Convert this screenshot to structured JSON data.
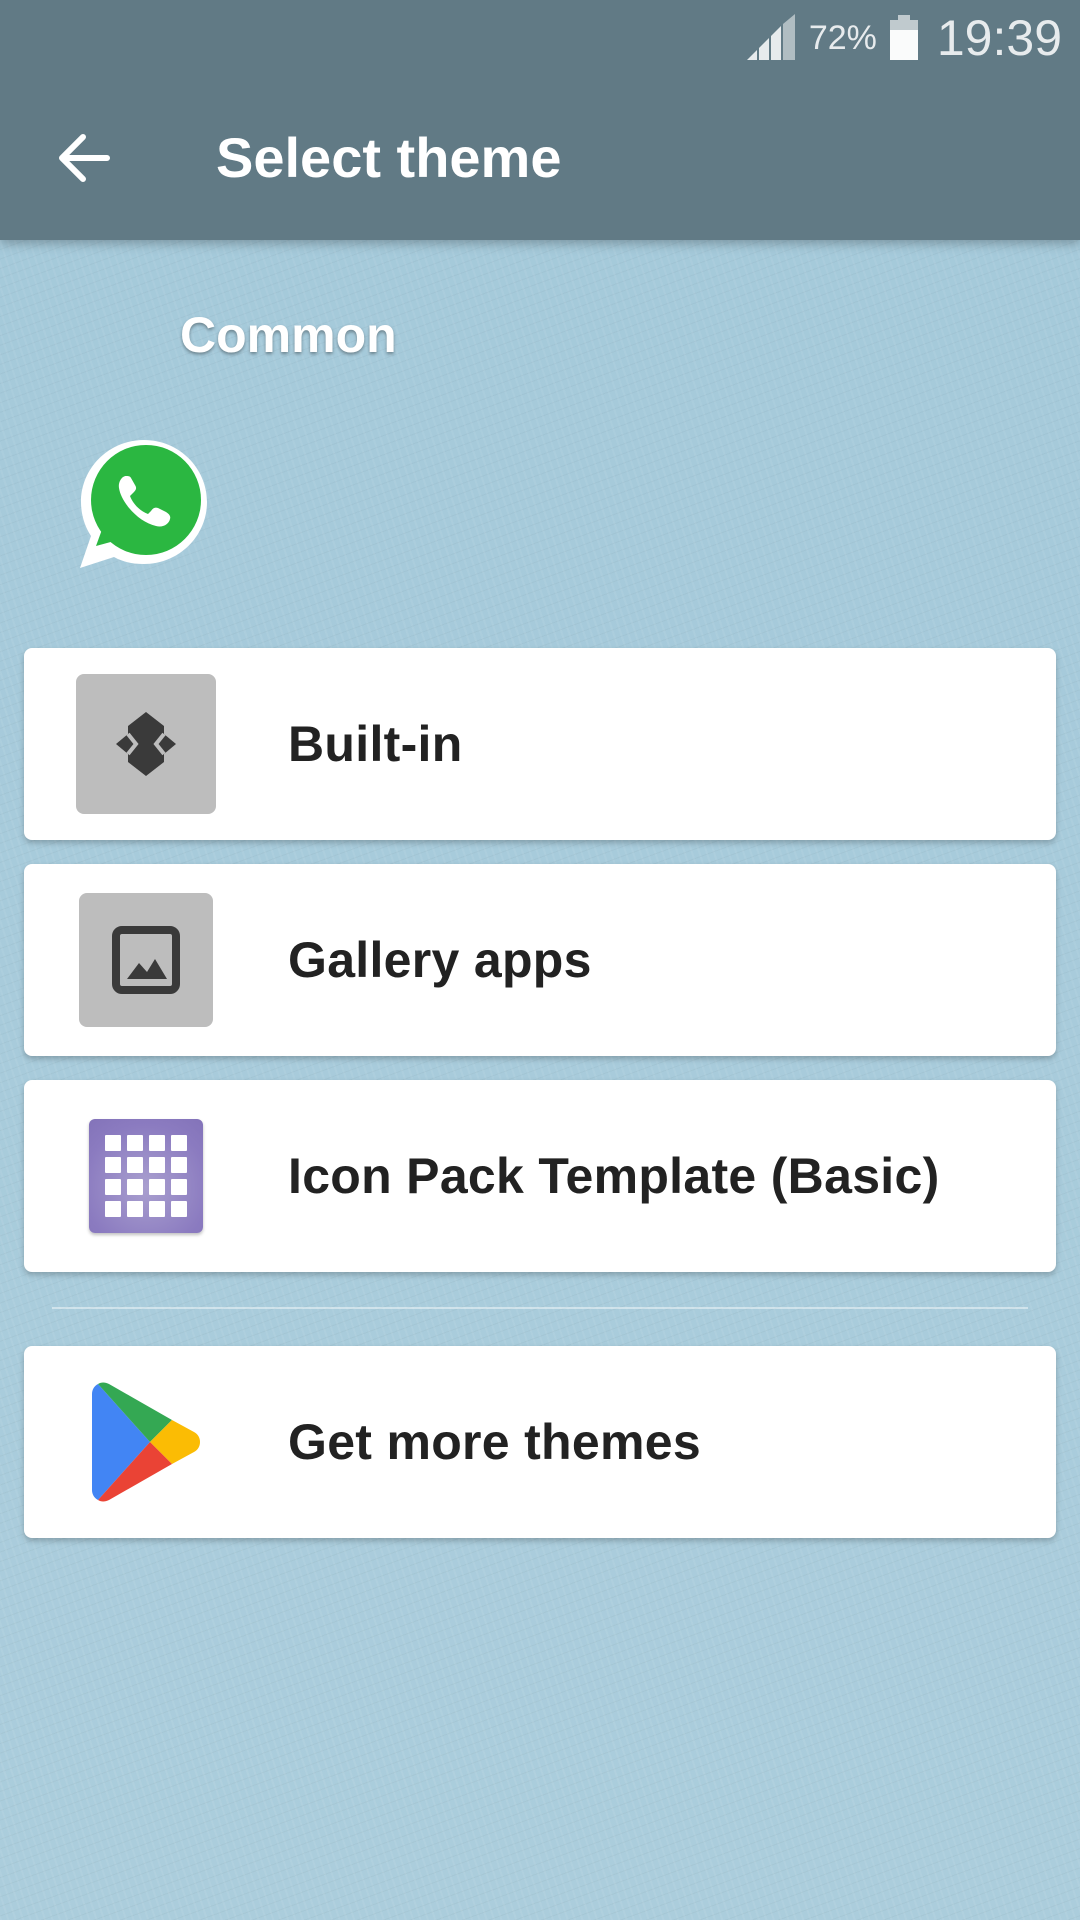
{
  "status_bar": {
    "battery_percent": "72%",
    "time": "19:39",
    "icons": [
      "signal-icon",
      "battery-icon"
    ]
  },
  "appbar": {
    "title": "Select theme",
    "back_icon": "arrow-back-icon"
  },
  "section": {
    "label": "Common",
    "app_icon": "whatsapp-icon"
  },
  "themes": [
    {
      "label": "Built-in",
      "icon": "built-in-theme-icon"
    },
    {
      "label": "Gallery apps",
      "icon": "gallery-image-icon"
    },
    {
      "label": "Icon Pack Template (Basic)",
      "icon": "icon-pack-grid-icon"
    }
  ],
  "more": {
    "label": "Get more themes",
    "icon": "google-play-icon"
  },
  "colors": {
    "appbar": "#617a85",
    "background": "#a9ccdb",
    "card": "#ffffff",
    "text": "#222222"
  }
}
